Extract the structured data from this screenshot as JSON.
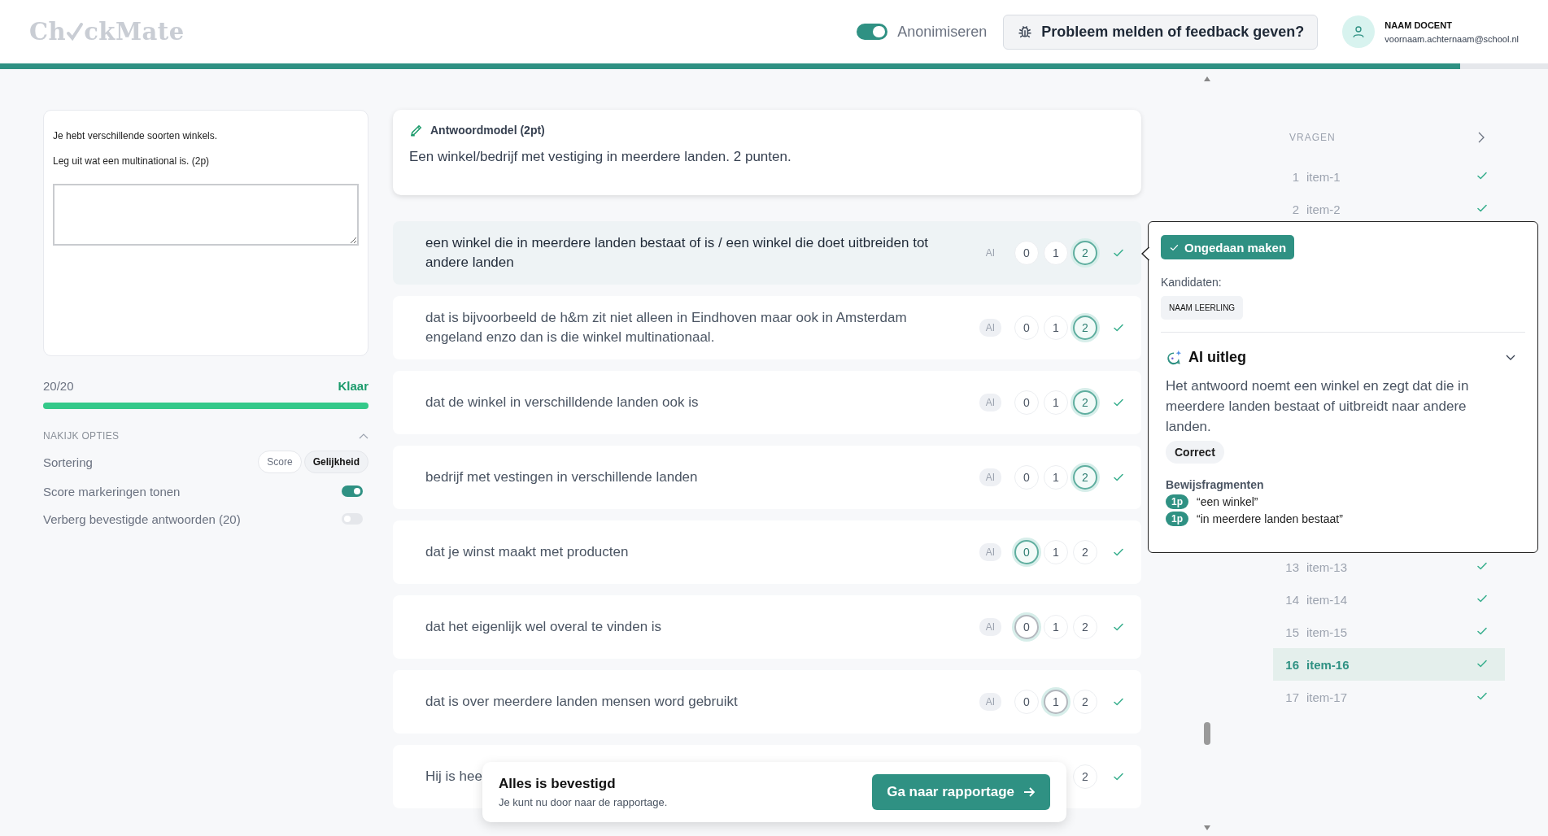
{
  "header": {
    "logo": {
      "before": "Ch",
      "after": "ckMate"
    },
    "anonymize": {
      "label": "Anonimiseren",
      "on": true
    },
    "feedback_button": "Probleem melden of feedback geven?",
    "user": {
      "name": "NAAM DOCENT",
      "email": "voornaam.achternaam@school.nl"
    },
    "progress": {
      "level": 0.943
    }
  },
  "question": {
    "lines": [
      "Je hebt verschillende soorten winkels.",
      "Leg uit wat een multinational is. (2p)"
    ]
  },
  "progress": {
    "count": "20/20",
    "status": "Klaar",
    "level": 1
  },
  "options": {
    "title": "NAKIJK OPTIES",
    "expanded": true,
    "sorting": {
      "label": "Sortering",
      "choices": [
        {
          "label": "Score",
          "selected": false
        },
        {
          "label": "Gelijkheid",
          "selected": true
        }
      ]
    },
    "toggles": [
      {
        "label": "Score markeringen tonen",
        "on": true
      },
      {
        "label": "Verberg bevestigde antwoorden (20)",
        "on": false
      }
    ]
  },
  "model_answer": {
    "title": "Antwoordmodel (2pt)",
    "text": "Een winkel/bedrijf met vestiging in meerdere landen. 2 punten."
  },
  "answers": [
    {
      "text": "een winkel die in meerdere landen bestaat of is / een winkel die doet uitbreiden tot andere landen",
      "selected": true,
      "ai": "AI",
      "suggested": true,
      "confirmed": true,
      "scores": [
        {
          "label": "0",
          "selected": false
        },
        {
          "label": "1",
          "selected": false
        },
        {
          "label": "2",
          "selected": true
        }
      ]
    },
    {
      "text": "dat is bijvoorbeeld de h&m zit niet alleen in Eindhoven maar ook in Amsterdam engeland enzo dan is die winkel multinationaal.",
      "selected": false,
      "ai": "AI",
      "suggested": true,
      "confirmed": true,
      "scores": [
        {
          "label": "0",
          "selected": false
        },
        {
          "label": "1",
          "selected": false
        },
        {
          "label": "2",
          "selected": true
        }
      ]
    },
    {
      "text": "dat de winkel in verschilldende landen ook is",
      "selected": false,
      "ai": "AI",
      "suggested": true,
      "confirmed": true,
      "scores": [
        {
          "label": "0",
          "selected": false
        },
        {
          "label": "1",
          "selected": false
        },
        {
          "label": "2",
          "selected": true
        }
      ]
    },
    {
      "text": "bedrijf met vestingen in verschillende landen",
      "selected": false,
      "ai": "AI",
      "suggested": true,
      "confirmed": true,
      "scores": [
        {
          "label": "0",
          "selected": false
        },
        {
          "label": "1",
          "selected": false
        },
        {
          "label": "2",
          "selected": true
        }
      ]
    },
    {
      "text": "dat je winst maakt met producten",
      "selected": false,
      "ai": "AI",
      "suggested": true,
      "confirmed": true,
      "scores": [
        {
          "label": "0",
          "selected": true
        },
        {
          "label": "1",
          "selected": false
        },
        {
          "label": "2",
          "selected": false
        }
      ]
    },
    {
      "text": "dat het eigenlijk wel overal te vinden is",
      "selected": false,
      "ai": "AI",
      "suggested": false,
      "confirmed": true,
      "scores": [
        {
          "label": "0",
          "selected": true
        },
        {
          "label": "1",
          "selected": false
        },
        {
          "label": "2",
          "selected": false
        }
      ]
    },
    {
      "text": "dat is over meerdere landen mensen word gebruikt",
      "selected": false,
      "ai": "AI",
      "suggested": false,
      "confirmed": true,
      "scores": [
        {
          "label": "0",
          "selected": false
        },
        {
          "label": "1",
          "selected": true
        },
        {
          "label": "2",
          "selected": false
        }
      ]
    },
    {
      "text": "Hij is hee",
      "selected": false,
      "confirmed": true,
      "scores": [
        {
          "label": "2",
          "selected": false
        }
      ]
    }
  ],
  "popup": {
    "undo_button": "Ongedaan maken",
    "candidates_label": "Kandidaten:",
    "candidates": [
      "NAAM LEERLING"
    ],
    "ai_title": "AI uitleg",
    "explanation": "Het antwoord noemt een winkel en zegt dat die in meerdere landen bestaat of uitbreidt naar andere landen.",
    "verdict": "Correct",
    "evidence_title": "Bewijsfragmenten",
    "evidence": [
      {
        "points": "1p",
        "quote": "“een winkel”"
      },
      {
        "points": "1p",
        "quote": "“in meerdere landen bestaat”"
      }
    ]
  },
  "sidebar": {
    "title": "VRAGEN",
    "items_top": [
      {
        "number": "1",
        "label": "item-1",
        "selected": false,
        "done": true
      },
      {
        "number": "2",
        "label": "item-2",
        "selected": false,
        "done": true
      }
    ],
    "items_bottom": [
      {
        "number": "13",
        "label": "item-13",
        "selected": false,
        "done": true
      },
      {
        "number": "14",
        "label": "item-14",
        "selected": false,
        "done": true
      },
      {
        "number": "15",
        "label": "item-15",
        "selected": false,
        "done": true
      },
      {
        "number": "16",
        "label": "item-16",
        "selected": true,
        "done": true
      },
      {
        "number": "17",
        "label": "item-17",
        "selected": false,
        "done": true
      }
    ]
  },
  "toast": {
    "title": "Alles is bevestigd",
    "text": "Je kunt nu door naar de rapportage.",
    "button": "Ga naar rapportage"
  }
}
